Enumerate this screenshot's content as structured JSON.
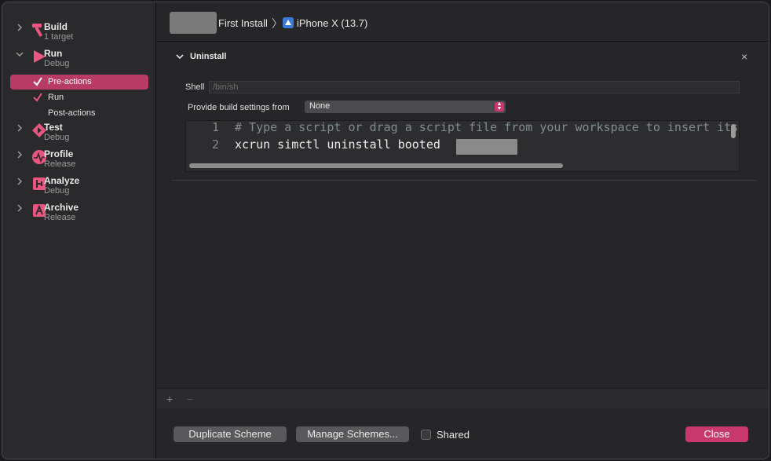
{
  "sidebar": {
    "actions": [
      {
        "name": "Build",
        "subtitle": "1 target",
        "expanded": false
      },
      {
        "name": "Run",
        "subtitle": "Debug",
        "expanded": true
      },
      {
        "name": "Test",
        "subtitle": "Debug",
        "expanded": false
      },
      {
        "name": "Profile",
        "subtitle": "Release",
        "expanded": false
      },
      {
        "name": "Analyze",
        "subtitle": "Debug",
        "expanded": false
      },
      {
        "name": "Archive",
        "subtitle": "Release",
        "expanded": false
      }
    ],
    "run_subitems": [
      {
        "label": "Pre-actions",
        "checked": true,
        "selected": true
      },
      {
        "label": "Run",
        "checked": true,
        "selected": false
      },
      {
        "label": "Post-actions",
        "checked": false,
        "selected": false
      }
    ]
  },
  "breadcrumb": {
    "scheme": "First Install",
    "separator": "〉",
    "device": "iPhone X (13.7)"
  },
  "panel": {
    "title": "Uninstall",
    "close_glyph": "×",
    "shell_label": "Shell",
    "shell_placeholder": "/bin/sh",
    "build_settings_label": "Provide build settings from",
    "build_settings_value": "None",
    "script_lines": [
      {
        "number": "1",
        "text": "# Type a script or drag a script file from your workspace to insert its path."
      },
      {
        "number": "2",
        "text": "xcrun simctl uninstall booted"
      }
    ]
  },
  "toolbar": {
    "add_glyph": "+",
    "remove_glyph": "−"
  },
  "footer": {
    "duplicate_label": "Duplicate Scheme",
    "manage_label": "Manage Schemes...",
    "shared_label": "Shared",
    "shared_checked": false,
    "close_label": "Close"
  },
  "colors": {
    "accent": "#c8386a",
    "selection": "#b83b66",
    "window_bg": "#262628",
    "sidebar_bg": "#2a2a2c"
  },
  "icons": {
    "build": "hammer-icon",
    "run": "play-icon",
    "test": "test-diamond-icon",
    "profile": "waveform-icon",
    "analyze": "analyze-icon",
    "archive": "archive-icon",
    "device": "simulator-icon"
  }
}
